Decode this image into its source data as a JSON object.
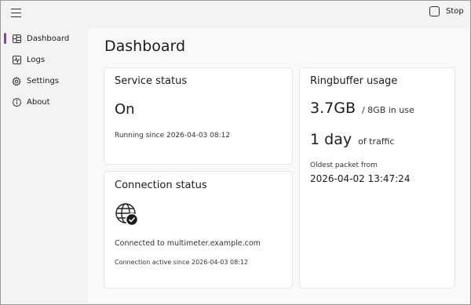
{
  "topbar": {
    "menu_icon": "hamburger-icon",
    "stop_label": "Stop",
    "stop_icon": "stop-square-icon"
  },
  "sidebar": {
    "items": [
      {
        "label": "Dashboard",
        "icon": "dashboard-icon",
        "active": true
      },
      {
        "label": "Logs",
        "icon": "logs-icon"
      },
      {
        "label": "Settings",
        "icon": "settings-icon"
      },
      {
        "label": "About",
        "icon": "info-icon"
      }
    ]
  },
  "page": {
    "title": "Dashboard"
  },
  "service_status": {
    "title": "Service status",
    "value": "On",
    "since": "Running since 2026-04-03 08:12"
  },
  "connection_status": {
    "title": "Connection status",
    "icon": "globe-check-icon",
    "host_text": "Connected to multimeter.example.com",
    "since": "Connection active since 2026-04-03 08:12"
  },
  "ringbuffer": {
    "title": "Ringbuffer usage",
    "size_value": "3.7GB",
    "size_detail": "/ 8GB in use",
    "duration_value": "1 day",
    "duration_detail": "of traffic",
    "oldest_label": "Oldest packet from",
    "oldest_value": "2026-04-02 13:47:24"
  },
  "colors": {
    "accent": "#8a3ab9",
    "background": "#f3f3f3",
    "content": "#f9f9f9",
    "card": "#ffffff"
  }
}
